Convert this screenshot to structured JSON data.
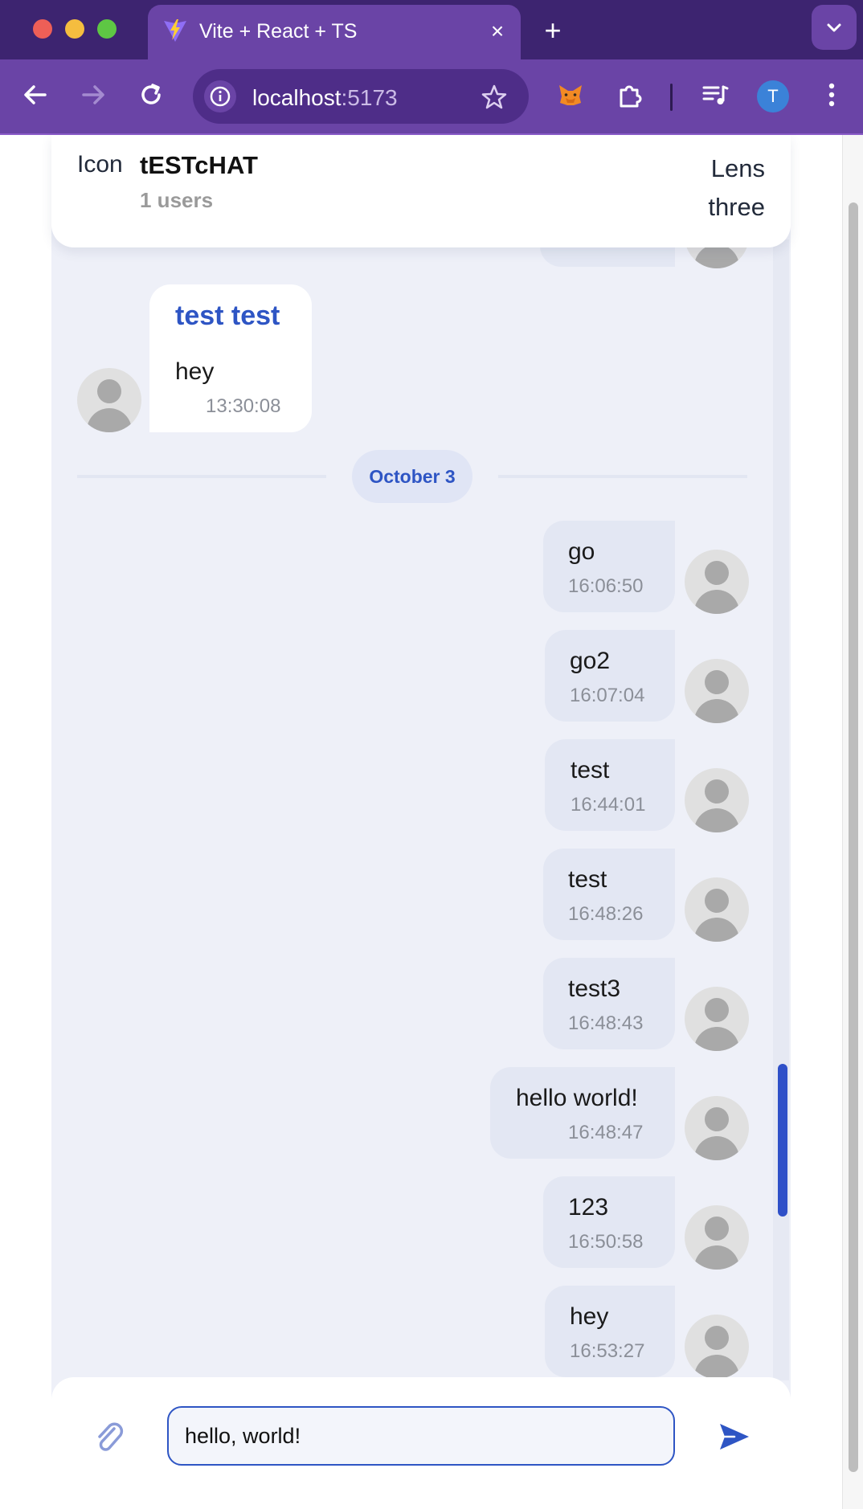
{
  "browser": {
    "tab_title": "Vite + React + TS",
    "tab_close": "×",
    "new_tab": "+",
    "url_host": "localhost",
    "url_port": ":5173",
    "profile_initial": "T"
  },
  "header": {
    "icon_label": "Icon",
    "title": "tESTcHAT",
    "users": "1 users",
    "right_label_line1": "Lens",
    "right_label_line2": "three"
  },
  "incoming": {
    "sender": "test test",
    "text": "hey",
    "time": "13:30:08"
  },
  "date_divider": "October 3",
  "outgoing": [
    {
      "text": "go",
      "time": "16:06:50"
    },
    {
      "text": "go2",
      "time": "16:07:04"
    },
    {
      "text": "test",
      "time": "16:44:01"
    },
    {
      "text": "test",
      "time": "16:48:26"
    },
    {
      "text": "test3",
      "time": "16:48:43"
    },
    {
      "text": "hello world!",
      "time": "16:48:47"
    },
    {
      "text": "123",
      "time": "16:50:58"
    },
    {
      "text": "hey",
      "time": "16:53:27"
    }
  ],
  "composer": {
    "value": "hello, world!"
  },
  "colors": {
    "accent": "#2e55c4",
    "browser_frame": "#6a44a6",
    "chat_background": "#eef0f8",
    "outgoing_bubble": "#e3e7f3"
  }
}
